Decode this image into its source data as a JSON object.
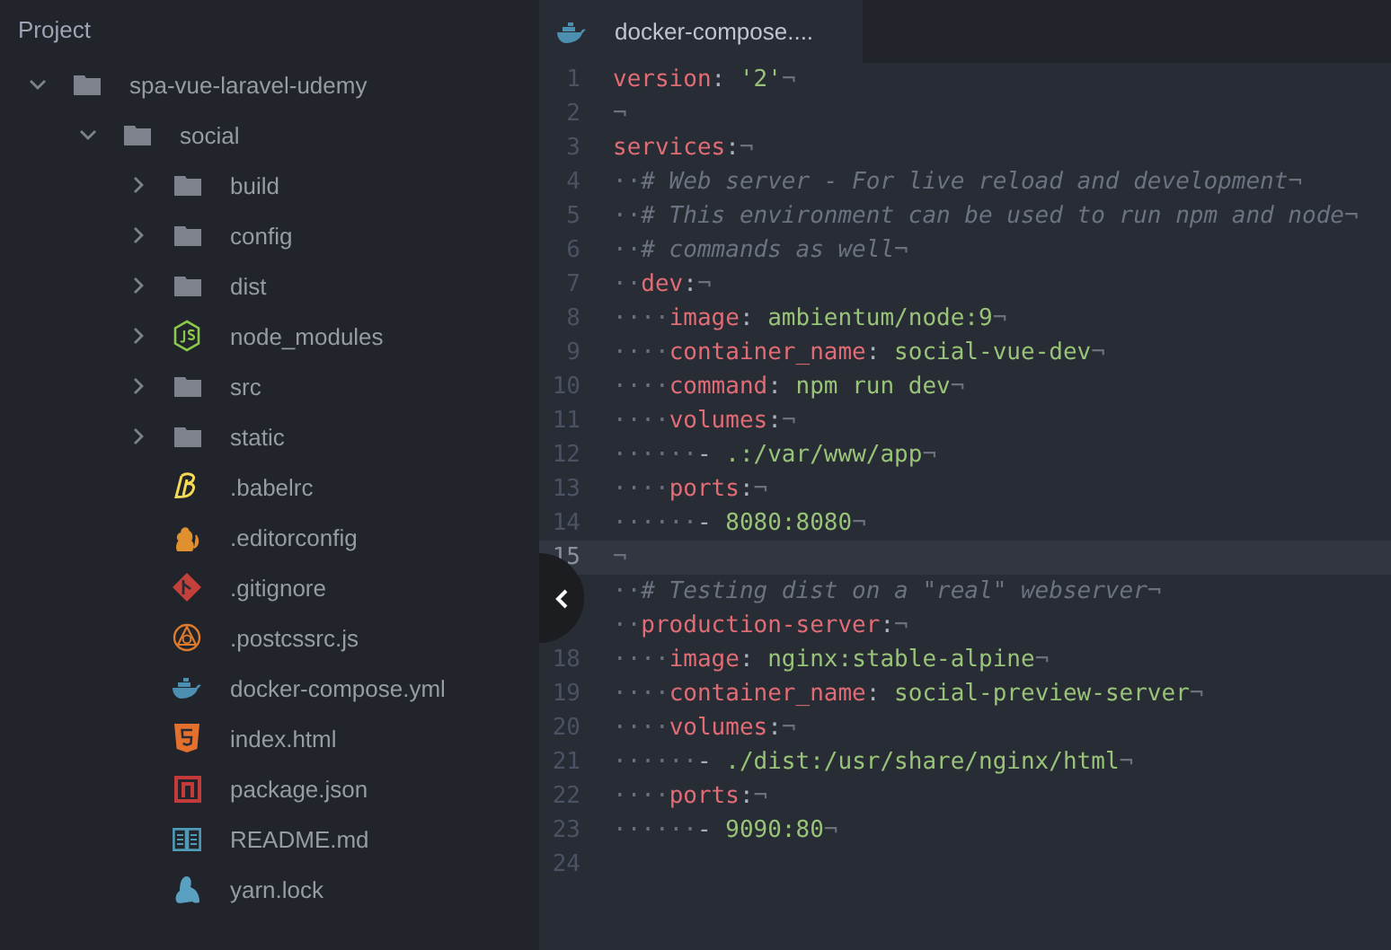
{
  "sidebar": {
    "title": "Project",
    "tree": [
      {
        "label": "spa-vue-laravel-udemy",
        "kind": "folder",
        "expanded": true,
        "children": [
          {
            "label": "social",
            "kind": "folder",
            "expanded": true,
            "children": [
              {
                "label": "build",
                "kind": "folder",
                "expanded": false
              },
              {
                "label": "config",
                "kind": "folder",
                "expanded": false
              },
              {
                "label": "dist",
                "kind": "folder",
                "expanded": false
              },
              {
                "label": "node_modules",
                "kind": "node-folder",
                "expanded": false
              },
              {
                "label": "src",
                "kind": "folder",
                "expanded": false
              },
              {
                "label": "static",
                "kind": "folder",
                "expanded": false
              },
              {
                "label": ".babelrc",
                "kind": "babel"
              },
              {
                "label": ".editorconfig",
                "kind": "editorconfig"
              },
              {
                "label": ".gitignore",
                "kind": "git"
              },
              {
                "label": ".postcssrc.js",
                "kind": "postcss"
              },
              {
                "label": "docker-compose.yml",
                "kind": "docker"
              },
              {
                "label": "index.html",
                "kind": "html"
              },
              {
                "label": "package.json",
                "kind": "npm"
              },
              {
                "label": "README.md",
                "kind": "readme"
              },
              {
                "label": "yarn.lock",
                "kind": "yarn"
              }
            ]
          }
        ]
      }
    ]
  },
  "editor": {
    "tab": {
      "title": "docker-compose....",
      "kind": "docker",
      "selected": true
    },
    "lines": [
      {
        "number": "1",
        "current": false,
        "tokens": [
          {
            "kind": "key",
            "text": "version"
          },
          {
            "kind": "punct",
            "text": ": "
          },
          {
            "kind": "str",
            "text": "'2'"
          },
          {
            "kind": "ws",
            "text": "¬"
          }
        ]
      },
      {
        "number": "2",
        "current": false,
        "tokens": [
          {
            "kind": "ws",
            "text": "¬"
          }
        ]
      },
      {
        "number": "3",
        "current": false,
        "tokens": [
          {
            "kind": "key",
            "text": "services"
          },
          {
            "kind": "punct",
            "text": ":"
          },
          {
            "kind": "ws",
            "text": "¬"
          }
        ]
      },
      {
        "number": "4",
        "current": false,
        "tokens": [
          {
            "kind": "ws",
            "text": "··"
          },
          {
            "kind": "comment",
            "text": "# Web server - For live reload and development"
          },
          {
            "kind": "ws",
            "text": "¬"
          }
        ]
      },
      {
        "number": "5",
        "current": false,
        "tokens": [
          {
            "kind": "ws",
            "text": "··"
          },
          {
            "kind": "comment",
            "text": "# This environment can be used to run npm and node"
          },
          {
            "kind": "ws",
            "text": "¬"
          }
        ]
      },
      {
        "number": "6",
        "current": false,
        "tokens": [
          {
            "kind": "ws",
            "text": "··"
          },
          {
            "kind": "comment",
            "text": "# commands as well"
          },
          {
            "kind": "ws",
            "text": "¬"
          }
        ]
      },
      {
        "number": "7",
        "current": false,
        "tokens": [
          {
            "kind": "ws",
            "text": "··"
          },
          {
            "kind": "key",
            "text": "dev"
          },
          {
            "kind": "punct",
            "text": ":"
          },
          {
            "kind": "ws",
            "text": "¬"
          }
        ]
      },
      {
        "number": "8",
        "current": false,
        "tokens": [
          {
            "kind": "ws",
            "text": "····"
          },
          {
            "kind": "key",
            "text": "image"
          },
          {
            "kind": "punct",
            "text": ": "
          },
          {
            "kind": "str",
            "text": "ambientum/node:9"
          },
          {
            "kind": "ws",
            "text": "¬"
          }
        ]
      },
      {
        "number": "9",
        "current": false,
        "tokens": [
          {
            "kind": "ws",
            "text": "····"
          },
          {
            "kind": "key",
            "text": "container_name"
          },
          {
            "kind": "punct",
            "text": ": "
          },
          {
            "kind": "str",
            "text": "social-vue-dev"
          },
          {
            "kind": "ws",
            "text": "¬"
          }
        ]
      },
      {
        "number": "10",
        "current": false,
        "tokens": [
          {
            "kind": "ws",
            "text": "····"
          },
          {
            "kind": "key",
            "text": "command"
          },
          {
            "kind": "punct",
            "text": ": "
          },
          {
            "kind": "str",
            "text": "npm run dev"
          },
          {
            "kind": "ws",
            "text": "¬"
          }
        ]
      },
      {
        "number": "11",
        "current": false,
        "tokens": [
          {
            "kind": "ws",
            "text": "····"
          },
          {
            "kind": "key",
            "text": "volumes"
          },
          {
            "kind": "punct",
            "text": ":"
          },
          {
            "kind": "ws",
            "text": "¬"
          }
        ]
      },
      {
        "number": "12",
        "current": false,
        "tokens": [
          {
            "kind": "ws",
            "text": "······"
          },
          {
            "kind": "punct",
            "text": "- "
          },
          {
            "kind": "str",
            "text": ".:/var/www/app"
          },
          {
            "kind": "ws",
            "text": "¬"
          }
        ]
      },
      {
        "number": "13",
        "current": false,
        "tokens": [
          {
            "kind": "ws",
            "text": "····"
          },
          {
            "kind": "key",
            "text": "ports"
          },
          {
            "kind": "punct",
            "text": ":"
          },
          {
            "kind": "ws",
            "text": "¬"
          }
        ]
      },
      {
        "number": "14",
        "current": false,
        "tokens": [
          {
            "kind": "ws",
            "text": "······"
          },
          {
            "kind": "punct",
            "text": "- "
          },
          {
            "kind": "str",
            "text": "8080:8080"
          },
          {
            "kind": "ws",
            "text": "¬"
          }
        ]
      },
      {
        "number": "15",
        "current": true,
        "tokens": [
          {
            "kind": "ws",
            "text": "¬"
          }
        ]
      },
      {
        "current": false,
        "tokens": [
          {
            "kind": "ws",
            "text": "··"
          },
          {
            "kind": "comment",
            "text": "# Testing dist on a \"real\" webserver"
          },
          {
            "kind": "ws",
            "text": "¬"
          }
        ]
      },
      {
        "current": false,
        "tokens": [
          {
            "kind": "ws",
            "text": "··"
          },
          {
            "kind": "key",
            "text": "production-server"
          },
          {
            "kind": "punct",
            "text": ":"
          },
          {
            "kind": "ws",
            "text": "¬"
          }
        ]
      },
      {
        "number": "18",
        "current": false,
        "tokens": [
          {
            "kind": "ws",
            "text": "····"
          },
          {
            "kind": "key",
            "text": "image"
          },
          {
            "kind": "punct",
            "text": ": "
          },
          {
            "kind": "str",
            "text": "nginx:stable-alpine"
          },
          {
            "kind": "ws",
            "text": "¬"
          }
        ]
      },
      {
        "number": "19",
        "current": false,
        "tokens": [
          {
            "kind": "ws",
            "text": "····"
          },
          {
            "kind": "key",
            "text": "container_name"
          },
          {
            "kind": "punct",
            "text": ": "
          },
          {
            "kind": "str",
            "text": "social-preview-server"
          },
          {
            "kind": "ws",
            "text": "¬"
          }
        ]
      },
      {
        "number": "20",
        "current": false,
        "tokens": [
          {
            "kind": "ws",
            "text": "····"
          },
          {
            "kind": "key",
            "text": "volumes"
          },
          {
            "kind": "punct",
            "text": ":"
          },
          {
            "kind": "ws",
            "text": "¬"
          }
        ]
      },
      {
        "number": "21",
        "current": false,
        "tokens": [
          {
            "kind": "ws",
            "text": "······"
          },
          {
            "kind": "punct",
            "text": "- "
          },
          {
            "kind": "str",
            "text": "./dist:/usr/share/nginx/html"
          },
          {
            "kind": "ws",
            "text": "¬"
          }
        ]
      },
      {
        "number": "22",
        "current": false,
        "tokens": [
          {
            "kind": "ws",
            "text": "····"
          },
          {
            "kind": "key",
            "text": "ports"
          },
          {
            "kind": "punct",
            "text": ":"
          },
          {
            "kind": "ws",
            "text": "¬"
          }
        ]
      },
      {
        "number": "23",
        "current": false,
        "tokens": [
          {
            "kind": "ws",
            "text": "······"
          },
          {
            "kind": "punct",
            "text": "- "
          },
          {
            "kind": "str",
            "text": "9090:80"
          },
          {
            "kind": "ws",
            "text": "¬"
          }
        ]
      },
      {
        "number": "24",
        "current": false
      }
    ]
  }
}
